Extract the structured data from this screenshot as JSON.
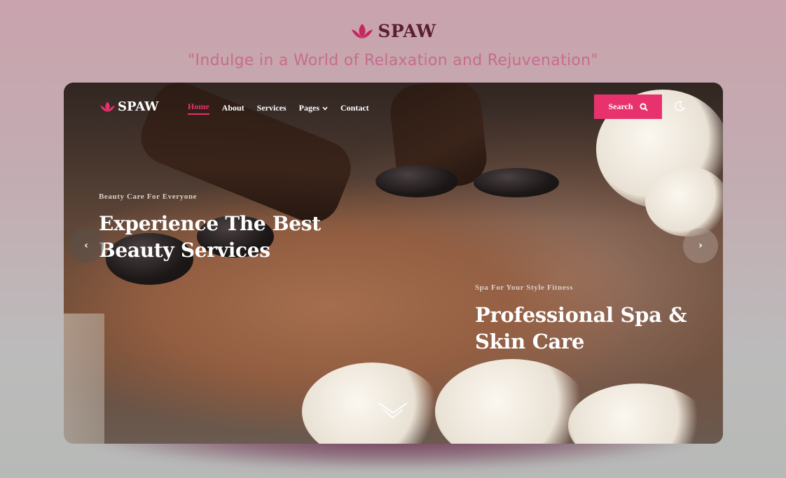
{
  "brand": {
    "name": "SPAW",
    "accent": "#e8326e",
    "logo_color": "#c4285e"
  },
  "tagline": "\"Indulge in a World of Relaxation and Rejuvenation\"",
  "nav": {
    "items": [
      {
        "label": "Home",
        "active": true
      },
      {
        "label": "About"
      },
      {
        "label": "Services"
      },
      {
        "label": "Pages",
        "dropdown": true
      },
      {
        "label": "Contact"
      }
    ],
    "search_label": "Search",
    "icons": {
      "search": "search-icon",
      "theme": "moon-icon",
      "dropdown": "chevron-down-icon"
    }
  },
  "slides": {
    "left": {
      "kicker": "Beauty Care For Everyone",
      "line1": "Experience The Best",
      "line2": "Beauty Services"
    },
    "right": {
      "kicker": "Spa For Your Style Fitness",
      "line1": "Professional Spa &",
      "line2": "Skin Care"
    }
  },
  "controls": {
    "prev": "‹",
    "next": "›",
    "scroll_icon": "double-chevron-down-icon"
  }
}
